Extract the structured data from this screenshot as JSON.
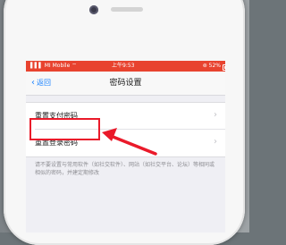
{
  "status_bar": {
    "carrier": "▌▌▌ MI Mobile ⌔",
    "time": "上午9:53",
    "battery": "⊚ 52%"
  },
  "nav": {
    "back_label": "返回",
    "title": "密码设置"
  },
  "settings": {
    "items": [
      {
        "label": "重置支付密码"
      },
      {
        "label": "重置登录密码"
      }
    ],
    "footnote": "请不要设置与常用软件（如社交软件）、网站（如社交平台、论坛）等相同或相似的密码，并建定期修改"
  },
  "annotation": {
    "highlight_color": "#ea1a2a"
  },
  "colors": {
    "status_bar": "#e8432f",
    "link": "#1a82ff"
  }
}
